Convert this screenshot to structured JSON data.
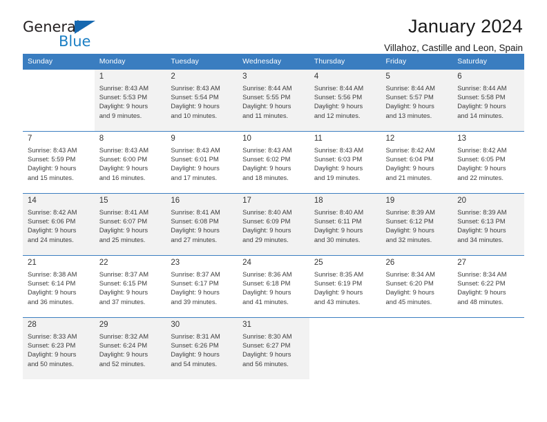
{
  "brand": {
    "name_part1": "General",
    "name_part2": "Blue",
    "logo_icon": "triangle-flag-icon"
  },
  "header": {
    "title": "January 2024",
    "subtitle": "Villahoz, Castille and Leon, Spain"
  },
  "calendar": {
    "weekday_headers": [
      "Sunday",
      "Monday",
      "Tuesday",
      "Wednesday",
      "Thursday",
      "Friday",
      "Saturday"
    ],
    "accent_color": "#3a7dc0",
    "shaded_row_color": "#f2f2f2",
    "labels": {
      "sunrise": "Sunrise:",
      "sunset": "Sunset:",
      "daylight": "Daylight:"
    },
    "weeks": [
      {
        "shaded": true,
        "days": [
          {
            "empty": true
          },
          {
            "num": "1",
            "sunrise": "Sunrise: 8:43 AM",
            "sunset": "Sunset: 5:53 PM",
            "daylight1": "Daylight: 9 hours",
            "daylight2": "and 9 minutes."
          },
          {
            "num": "2",
            "sunrise": "Sunrise: 8:43 AM",
            "sunset": "Sunset: 5:54 PM",
            "daylight1": "Daylight: 9 hours",
            "daylight2": "and 10 minutes."
          },
          {
            "num": "3",
            "sunrise": "Sunrise: 8:44 AM",
            "sunset": "Sunset: 5:55 PM",
            "daylight1": "Daylight: 9 hours",
            "daylight2": "and 11 minutes."
          },
          {
            "num": "4",
            "sunrise": "Sunrise: 8:44 AM",
            "sunset": "Sunset: 5:56 PM",
            "daylight1": "Daylight: 9 hours",
            "daylight2": "and 12 minutes."
          },
          {
            "num": "5",
            "sunrise": "Sunrise: 8:44 AM",
            "sunset": "Sunset: 5:57 PM",
            "daylight1": "Daylight: 9 hours",
            "daylight2": "and 13 minutes."
          },
          {
            "num": "6",
            "sunrise": "Sunrise: 8:44 AM",
            "sunset": "Sunset: 5:58 PM",
            "daylight1": "Daylight: 9 hours",
            "daylight2": "and 14 minutes."
          }
        ]
      },
      {
        "shaded": false,
        "days": [
          {
            "num": "7",
            "sunrise": "Sunrise: 8:43 AM",
            "sunset": "Sunset: 5:59 PM",
            "daylight1": "Daylight: 9 hours",
            "daylight2": "and 15 minutes."
          },
          {
            "num": "8",
            "sunrise": "Sunrise: 8:43 AM",
            "sunset": "Sunset: 6:00 PM",
            "daylight1": "Daylight: 9 hours",
            "daylight2": "and 16 minutes."
          },
          {
            "num": "9",
            "sunrise": "Sunrise: 8:43 AM",
            "sunset": "Sunset: 6:01 PM",
            "daylight1": "Daylight: 9 hours",
            "daylight2": "and 17 minutes."
          },
          {
            "num": "10",
            "sunrise": "Sunrise: 8:43 AM",
            "sunset": "Sunset: 6:02 PM",
            "daylight1": "Daylight: 9 hours",
            "daylight2": "and 18 minutes."
          },
          {
            "num": "11",
            "sunrise": "Sunrise: 8:43 AM",
            "sunset": "Sunset: 6:03 PM",
            "daylight1": "Daylight: 9 hours",
            "daylight2": "and 19 minutes."
          },
          {
            "num": "12",
            "sunrise": "Sunrise: 8:42 AM",
            "sunset": "Sunset: 6:04 PM",
            "daylight1": "Daylight: 9 hours",
            "daylight2": "and 21 minutes."
          },
          {
            "num": "13",
            "sunrise": "Sunrise: 8:42 AM",
            "sunset": "Sunset: 6:05 PM",
            "daylight1": "Daylight: 9 hours",
            "daylight2": "and 22 minutes."
          }
        ]
      },
      {
        "shaded": true,
        "days": [
          {
            "num": "14",
            "sunrise": "Sunrise: 8:42 AM",
            "sunset": "Sunset: 6:06 PM",
            "daylight1": "Daylight: 9 hours",
            "daylight2": "and 24 minutes."
          },
          {
            "num": "15",
            "sunrise": "Sunrise: 8:41 AM",
            "sunset": "Sunset: 6:07 PM",
            "daylight1": "Daylight: 9 hours",
            "daylight2": "and 25 minutes."
          },
          {
            "num": "16",
            "sunrise": "Sunrise: 8:41 AM",
            "sunset": "Sunset: 6:08 PM",
            "daylight1": "Daylight: 9 hours",
            "daylight2": "and 27 minutes."
          },
          {
            "num": "17",
            "sunrise": "Sunrise: 8:40 AM",
            "sunset": "Sunset: 6:09 PM",
            "daylight1": "Daylight: 9 hours",
            "daylight2": "and 29 minutes."
          },
          {
            "num": "18",
            "sunrise": "Sunrise: 8:40 AM",
            "sunset": "Sunset: 6:11 PM",
            "daylight1": "Daylight: 9 hours",
            "daylight2": "and 30 minutes."
          },
          {
            "num": "19",
            "sunrise": "Sunrise: 8:39 AM",
            "sunset": "Sunset: 6:12 PM",
            "daylight1": "Daylight: 9 hours",
            "daylight2": "and 32 minutes."
          },
          {
            "num": "20",
            "sunrise": "Sunrise: 8:39 AM",
            "sunset": "Sunset: 6:13 PM",
            "daylight1": "Daylight: 9 hours",
            "daylight2": "and 34 minutes."
          }
        ]
      },
      {
        "shaded": false,
        "days": [
          {
            "num": "21",
            "sunrise": "Sunrise: 8:38 AM",
            "sunset": "Sunset: 6:14 PM",
            "daylight1": "Daylight: 9 hours",
            "daylight2": "and 36 minutes."
          },
          {
            "num": "22",
            "sunrise": "Sunrise: 8:37 AM",
            "sunset": "Sunset: 6:15 PM",
            "daylight1": "Daylight: 9 hours",
            "daylight2": "and 37 minutes."
          },
          {
            "num": "23",
            "sunrise": "Sunrise: 8:37 AM",
            "sunset": "Sunset: 6:17 PM",
            "daylight1": "Daylight: 9 hours",
            "daylight2": "and 39 minutes."
          },
          {
            "num": "24",
            "sunrise": "Sunrise: 8:36 AM",
            "sunset": "Sunset: 6:18 PM",
            "daylight1": "Daylight: 9 hours",
            "daylight2": "and 41 minutes."
          },
          {
            "num": "25",
            "sunrise": "Sunrise: 8:35 AM",
            "sunset": "Sunset: 6:19 PM",
            "daylight1": "Daylight: 9 hours",
            "daylight2": "and 43 minutes."
          },
          {
            "num": "26",
            "sunrise": "Sunrise: 8:34 AM",
            "sunset": "Sunset: 6:20 PM",
            "daylight1": "Daylight: 9 hours",
            "daylight2": "and 45 minutes."
          },
          {
            "num": "27",
            "sunrise": "Sunrise: 8:34 AM",
            "sunset": "Sunset: 6:22 PM",
            "daylight1": "Daylight: 9 hours",
            "daylight2": "and 48 minutes."
          }
        ]
      },
      {
        "shaded": true,
        "days": [
          {
            "num": "28",
            "sunrise": "Sunrise: 8:33 AM",
            "sunset": "Sunset: 6:23 PM",
            "daylight1": "Daylight: 9 hours",
            "daylight2": "and 50 minutes."
          },
          {
            "num": "29",
            "sunrise": "Sunrise: 8:32 AM",
            "sunset": "Sunset: 6:24 PM",
            "daylight1": "Daylight: 9 hours",
            "daylight2": "and 52 minutes."
          },
          {
            "num": "30",
            "sunrise": "Sunrise: 8:31 AM",
            "sunset": "Sunset: 6:26 PM",
            "daylight1": "Daylight: 9 hours",
            "daylight2": "and 54 minutes."
          },
          {
            "num": "31",
            "sunrise": "Sunrise: 8:30 AM",
            "sunset": "Sunset: 6:27 PM",
            "daylight1": "Daylight: 9 hours",
            "daylight2": "and 56 minutes."
          },
          {
            "empty": true
          },
          {
            "empty": true
          },
          {
            "empty": true
          }
        ]
      }
    ]
  }
}
